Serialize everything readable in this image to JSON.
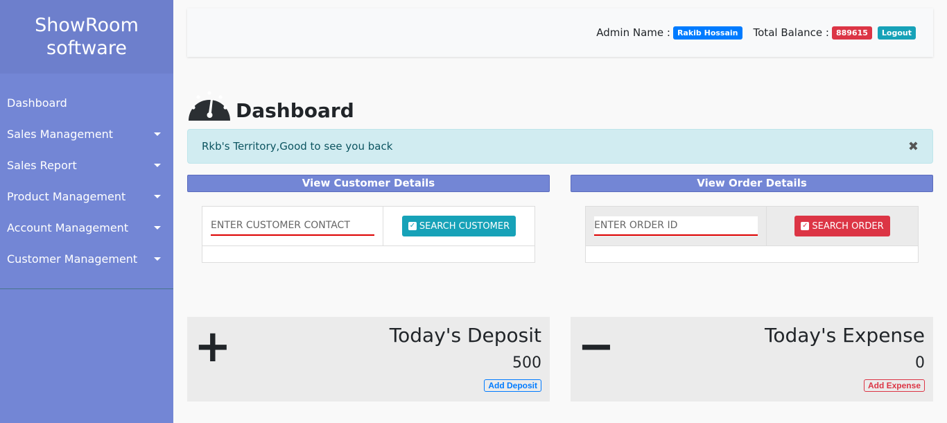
{
  "sidebar": {
    "brand": "ShowRoom software",
    "items": [
      {
        "label": "Dashboard",
        "has_caret": false
      },
      {
        "label": "Sales Management",
        "has_caret": true
      },
      {
        "label": "Sales Report",
        "has_caret": true
      },
      {
        "label": "Product Management",
        "has_caret": true
      },
      {
        "label": "Account Management",
        "has_caret": true
      },
      {
        "label": "Customer Management",
        "has_caret": true
      }
    ]
  },
  "header": {
    "admin_label": "Admin Name :",
    "admin_name": "Rakib Hossain",
    "balance_label": "Total Balance :",
    "balance_value": "889615",
    "logout_label": "Logout"
  },
  "page": {
    "title": "Dashboard",
    "title_icon": "dashboard-gauge-icon"
  },
  "alert": {
    "message": "Rkb's Territory,Good to see you back",
    "close_glyph": "✖"
  },
  "customer_panel": {
    "heading": "View Customer Details",
    "input_placeholder": "ENTER CUSTOMER CONTACT",
    "button_label": "SEARCH CUSTOMER"
  },
  "order_panel": {
    "heading": "View Order Details",
    "input_placeholder": "ENTER ORDER ID",
    "button_label": "SEARCH ORDER"
  },
  "deposit_card": {
    "symbol": "+",
    "title": "Today's Deposit",
    "value": "500",
    "button_label": "Add Deposit"
  },
  "expense_card": {
    "symbol": "−",
    "title": "Today's Expense",
    "value": "0",
    "button_label": "Add Expense"
  },
  "colors": {
    "sidebar_bg": "#7386d5",
    "brand_bg": "#6d7fcc",
    "primary": "#007bff",
    "danger": "#dc3545",
    "info": "#17a2b8",
    "alert_bg": "#d1ecf1"
  }
}
